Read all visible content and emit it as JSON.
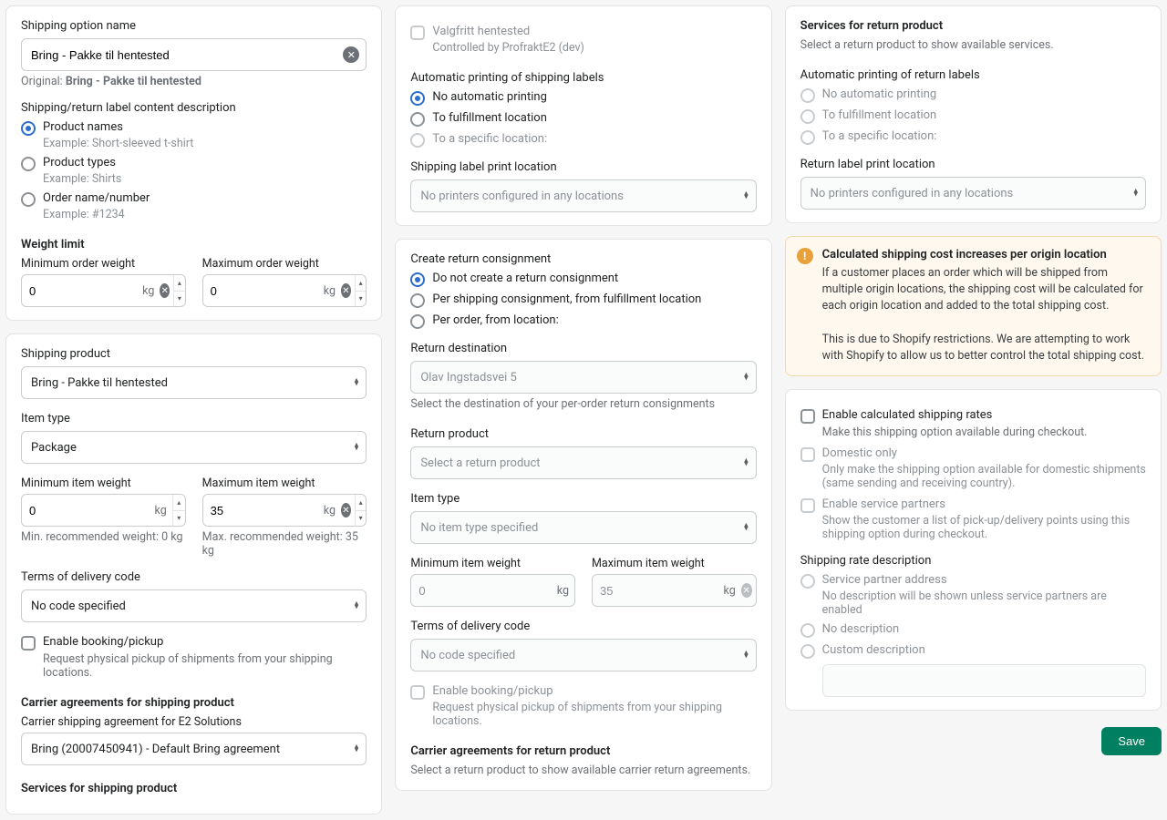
{
  "left": {
    "shipping_option_name_label": "Shipping option name",
    "shipping_option_name_value": "Bring - Pakke til hentested",
    "original_prefix": "Original: ",
    "original_value": "Bring - Pakke til hentested",
    "label_desc_label": "Shipping/return label content description",
    "label_opts": {
      "product_names": "Product names",
      "product_names_ex": "Example: Short-sleeved t-shirt",
      "product_types": "Product types",
      "product_types_ex": "Example: Shirts",
      "order_name": "Order name/number",
      "order_name_ex": "Example: #1234"
    },
    "weight_limit_title": "Weight limit",
    "min_order_weight_label": "Minimum order weight",
    "min_order_weight_value": "0",
    "max_order_weight_label": "Maximum order weight",
    "max_order_weight_value": "0",
    "unit_kg": "kg",
    "shipping_product_label": "Shipping product",
    "shipping_product_value": "Bring - Pakke til hentested",
    "item_type_label": "Item type",
    "item_type_value": "Package",
    "min_item_weight_label": "Minimum item weight",
    "min_item_weight_value": "0",
    "min_item_weight_hint": "Min. recommended weight: 0 kg",
    "max_item_weight_label": "Maximum item weight",
    "max_item_weight_value": "35",
    "max_item_weight_hint": "Max. recommended weight: 35 kg",
    "terms_label": "Terms of delivery code",
    "terms_value": "No code specified",
    "enable_booking_label": "Enable booking/pickup",
    "enable_booking_hint": "Request physical pickup of shipments from your shipping locations.",
    "carrier_agreements_title": "Carrier agreements for shipping product",
    "carrier_agreement_label": "Carrier shipping agreement for E2 Solutions",
    "carrier_agreement_value": "Bring (20007450941) - Default Bring agreement",
    "services_title": "Services for shipping product"
  },
  "mid": {
    "valgfritt_label": "Valgfritt hentested",
    "valgfritt_hint": "Controlled by ProfraktE2 (dev)",
    "auto_print_title": "Automatic printing of shipping labels",
    "auto_print_opts": {
      "none": "No automatic printing",
      "to_fulfillment": "To fulfillment location",
      "to_specific": "To a specific location:"
    },
    "print_location_label": "Shipping label print location",
    "print_location_value": "No printers configured in any locations",
    "create_return_title": "Create return consignment",
    "create_return_opts": {
      "dont": "Do not create a return consignment",
      "per_shipping": "Per shipping consignment, from fulfillment location",
      "per_order": "Per order, from location:"
    },
    "return_dest_label": "Return destination",
    "return_dest_value": "Olav Ingstadsvei 5",
    "return_dest_hint": "Select the destination of your per-order return consignments",
    "return_product_label": "Return product",
    "return_product_value": "Select a return product",
    "item_type_label": "Item type",
    "item_type_value": "No item type specified",
    "min_item_weight_label": "Minimum item weight",
    "min_item_weight_value": "0",
    "max_item_weight_label": "Maximum item weight",
    "max_item_weight_value": "35",
    "unit_kg": "kg",
    "terms_label": "Terms of delivery code",
    "terms_value": "No code specified",
    "enable_booking_label": "Enable booking/pickup",
    "enable_booking_hint": "Request physical pickup of shipments from your shipping locations.",
    "carrier_return_title": "Carrier agreements for return product",
    "carrier_return_hint": "Select a return product to show available carrier return agreements."
  },
  "right": {
    "services_return_title": "Services for return product",
    "services_return_hint": "Select a return product to show available services.",
    "auto_return_print_title": "Automatic printing of return labels",
    "auto_return_opts": {
      "none": "No automatic printing",
      "to_fulfillment": "To fulfillment location",
      "to_specific": "To a specific location:"
    },
    "return_print_location_label": "Return label print location",
    "return_print_location_value": "No printers configured in any locations",
    "alert_title": "Calculated shipping cost increases per origin location",
    "alert_body1": "If a customer places an order which will be shipped from multiple origin locations, the shipping cost will be calculated for each origin location and added to the total shipping cost.",
    "alert_body2": "This is due to Shopify restrictions. We are attempting to work with Shopify to allow us to better control the total shipping cost.",
    "enable_calc_label": "Enable calculated shipping rates",
    "enable_calc_hint": "Make this shipping option available during checkout.",
    "domestic_label": "Domestic only",
    "domestic_hint": "Only make the shipping option available for domestic shipments (same sending and receiving country).",
    "partners_label": "Enable service partners",
    "partners_hint": "Show the customer a list of pick-up/delivery points using this shipping option during checkout.",
    "rate_desc_title": "Shipping rate description",
    "rate_desc_opts": {
      "partner": "Service partner address",
      "partner_hint": "No description will be shown unless service partners are enabled",
      "none": "No description",
      "custom": "Custom description"
    },
    "save": "Save"
  }
}
